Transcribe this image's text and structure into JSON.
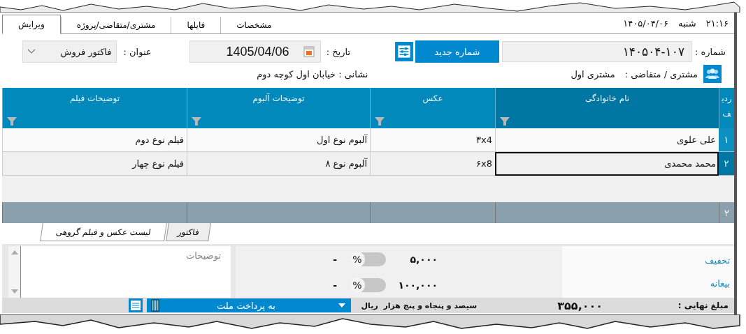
{
  "header": {
    "time": "۲۱:۱۶",
    "day": "شنبه",
    "date": "۱۴۰۵/۰۴/۰۶"
  },
  "tabs": [
    {
      "label": "مشخصات",
      "selected": false
    },
    {
      "label": "فایلها",
      "selected": false
    },
    {
      "label": "مشتری/متقاضی/پروژه",
      "selected": false
    },
    {
      "label": "ویرایش",
      "selected": true
    }
  ],
  "form": {
    "number_label": "شماره :",
    "number": "۱۴۰۵۰۴-۱۰۷",
    "new_number_button": "شماره جدید",
    "date_label": "تاریخ :",
    "date": "1405/04/06",
    "title_label": "عنوان :",
    "title": "فاکتور فروش",
    "customer_label": "مشتری / متقاضی :",
    "customer": "مشتری اول",
    "address": "نشانی : خیابان اول کوچه دوم"
  },
  "table": {
    "row_number_header": "ردیف",
    "columns": [
      "نام خانوادگی",
      "عکس",
      "توضیحات آلبوم",
      "توضیحات فیلم"
    ],
    "rows": [
      {
        "row_number": "۱",
        "selected": false,
        "cells": [
          "علی علوی",
          "۳x4",
          "آلبوم نوع اول",
          "فیلم نوع دوم"
        ]
      },
      {
        "row_number": "۲",
        "selected": true,
        "cells": [
          "محمد محمدی",
          "۶x8",
          "آلبوم نوع ۸",
          "فیلم نوع چهار"
        ]
      }
    ],
    "footer_count": "۲"
  },
  "subtabs": [
    {
      "label": "فاکتور",
      "selected": false
    },
    {
      "label": "لیست عکس و فیلم گروهی",
      "selected": true
    }
  ],
  "adjustments": [
    {
      "label": "تخفیف",
      "amount": "۵,۰۰۰",
      "percent": "%",
      "on": false,
      "dash": "-"
    },
    {
      "label": "بیعانه",
      "amount": "۱۰۰,۰۰۰",
      "percent": "%",
      "on": false,
      "dash": "-"
    }
  ],
  "notes": {
    "placeholder": "توضیحات"
  },
  "status": {
    "final_label": "مبلغ نهایی :",
    "final_amount": "۳۵۵,۰۰۰",
    "amount_words": "سیصد و پنجاه و پنج هزار  ریال",
    "payment": "به پرداخت ملت"
  }
}
